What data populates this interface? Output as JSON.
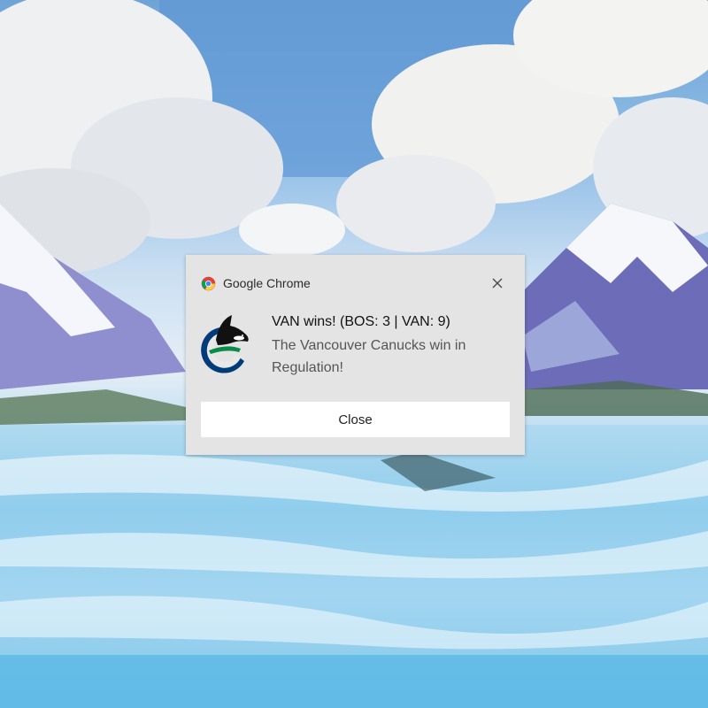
{
  "notification": {
    "app_name": "Google Chrome",
    "app_icon": "chrome-icon",
    "logo_icon": "vancouver-canucks-logo",
    "title": "VAN wins! (BOS: 3 | VAN: 9)",
    "body": "The Vancouver Canucks win in Regulation!",
    "close_icon": "close-icon",
    "action_label": "Close"
  },
  "colors": {
    "toast_background": "#e4e4e4",
    "button_background": "#ffffff",
    "title_text": "#111111",
    "body_text": "#555555"
  }
}
